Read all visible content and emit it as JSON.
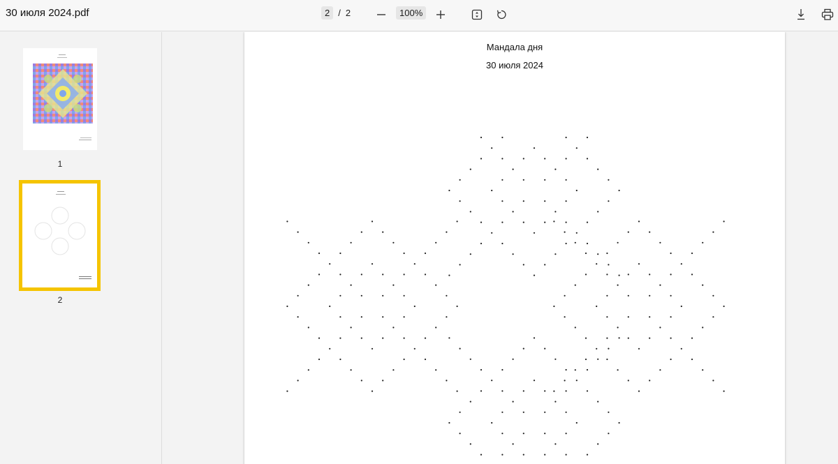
{
  "document": {
    "title": "30 июля 2024.pdf"
  },
  "navigation": {
    "current_page": "2",
    "separator": "/",
    "total_pages": "2"
  },
  "zoom": {
    "value": "100%"
  },
  "toolbar_icons": {
    "zoom_out": "minus-icon",
    "zoom_in": "plus-icon",
    "fit_page": "fit-page-icon",
    "rotate": "rotate-icon",
    "download": "download-icon",
    "print": "printer-icon"
  },
  "sidebar": {
    "thumbnails": [
      {
        "label": "1",
        "selected": false
      },
      {
        "label": "2",
        "selected": true
      }
    ],
    "selection_color": "#f5c400"
  },
  "page": {
    "title": "Мандала дня",
    "date": "30 июля 2024"
  }
}
